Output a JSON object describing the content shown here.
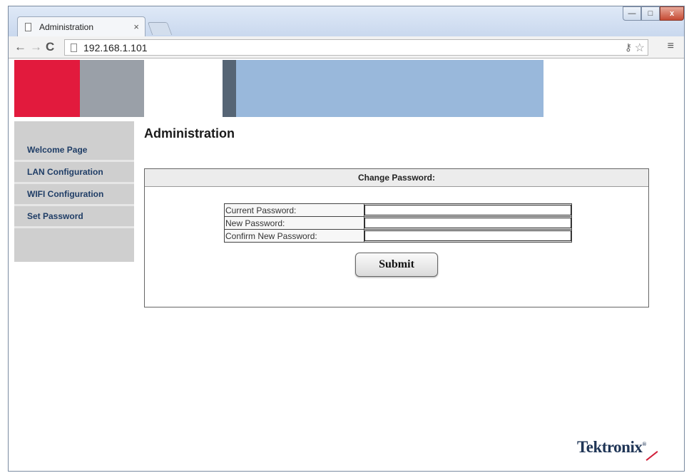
{
  "browser": {
    "tab_title": "Administration",
    "tab_close": "×",
    "url": "192.168.1.101",
    "window_controls": {
      "minimize": "—",
      "maximize": "□",
      "close": "x"
    },
    "icons": {
      "back": "←",
      "forward": "→",
      "reload": "C",
      "key": "⚷",
      "star": "☆",
      "menu": "≡"
    }
  },
  "sidebar": {
    "items": [
      {
        "label": "Welcome Page"
      },
      {
        "label": "LAN Configuration"
      },
      {
        "label": "WIFI Configuration"
      },
      {
        "label": "Set Password"
      }
    ]
  },
  "main": {
    "heading": "Administration",
    "panel_title": "Change Password:",
    "fields": [
      {
        "label": "Current Password:",
        "value": ""
      },
      {
        "label": "New Password:",
        "value": ""
      },
      {
        "label": "Confirm New Password:",
        "value": ""
      }
    ],
    "submit_label": "Submit"
  },
  "brand": {
    "name": "Tektronix",
    "mark": "®"
  },
  "colors": {
    "banner_red": "#e21a3d",
    "banner_gray": "#9aa0a8",
    "banner_dark": "#566575",
    "banner_blue": "#99b8db",
    "nav_text": "#1f3d66"
  }
}
